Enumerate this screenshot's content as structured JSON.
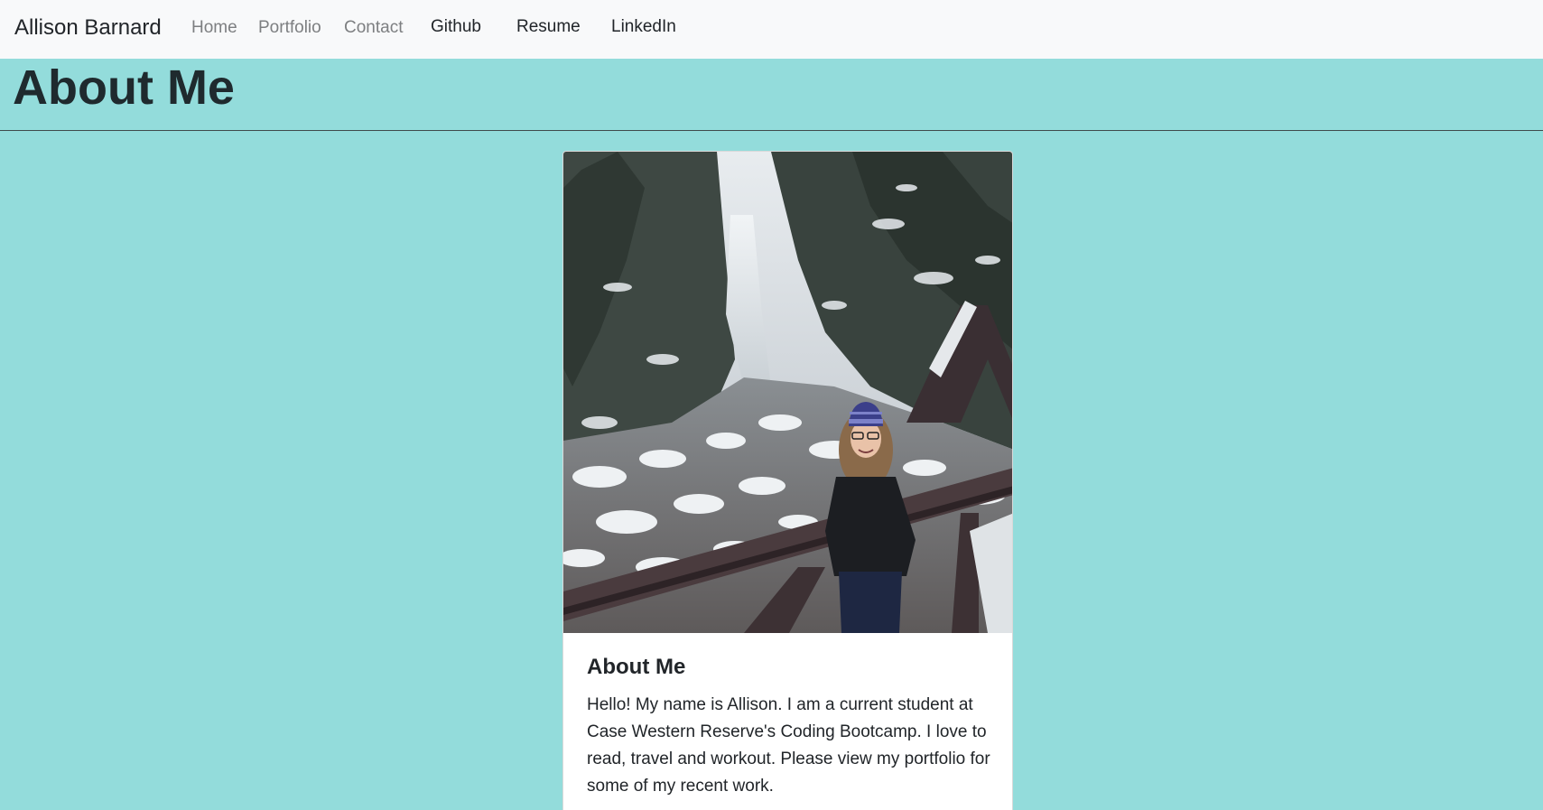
{
  "navbar": {
    "brand": "Allison Barnard",
    "links": [
      {
        "label": "Home"
      },
      {
        "label": "Portfolio"
      },
      {
        "label": "Contact"
      },
      {
        "label": "Github"
      },
      {
        "label": "Resume"
      },
      {
        "label": "LinkedIn"
      }
    ]
  },
  "page": {
    "heading": "About Me"
  },
  "card": {
    "title": "About Me",
    "text": "Hello! My name is Allison. I am a current student at Case Western Reserve's Coding Bootcamp. I love to read, travel and workout. Please view my portfolio for some of my recent work."
  },
  "colors": {
    "page_background": "#93dcdb",
    "navbar_background": "#f8f9fa"
  }
}
